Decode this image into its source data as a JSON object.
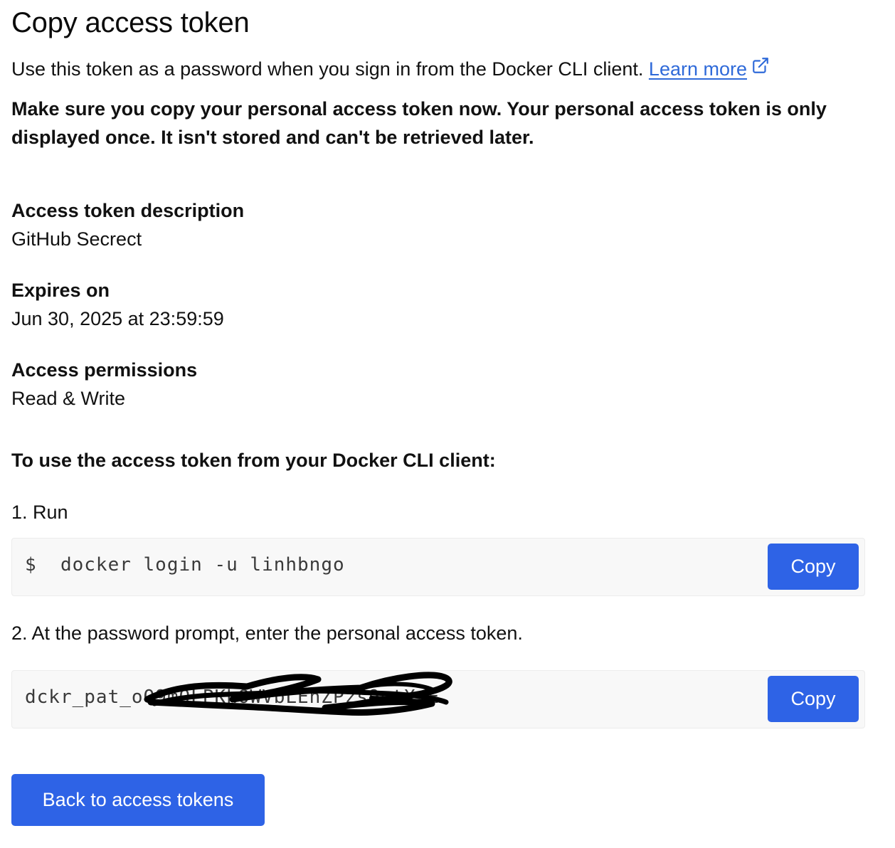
{
  "page": {
    "title": "Copy access token",
    "intro_text": "Use this token as a password when you sign in from the Docker CLI client. ",
    "learn_more_label": "Learn more",
    "warning": "Make sure you copy your personal access token now. Your personal access token is only displayed once. It isn't stored and can't be retrieved later."
  },
  "details": {
    "description_label": "Access token description",
    "description_value": "GitHub Secrect",
    "expires_label": "Expires on",
    "expires_value": "Jun 30, 2025 at 23:59:59",
    "permissions_label": "Access permissions",
    "permissions_value": "Read & Write"
  },
  "instructions": {
    "heading": "To use the access token from your Docker CLI client:",
    "step1": "1. Run",
    "step1_command": "$  docker login -u linhbngo",
    "step2": "2. At the password prompt, enter the personal access token.",
    "token_value": "dckr_pat_oQ9mOLPKhOWVbLEhZPzs9otXsE",
    "copy_label": "Copy"
  },
  "footer": {
    "back_label": "Back to access tokens"
  },
  "colors": {
    "accent": "#2e63e6",
    "link": "#2f6ad9"
  },
  "icons": {
    "external_link": "external-link-icon",
    "redaction": "redaction-scribble"
  }
}
